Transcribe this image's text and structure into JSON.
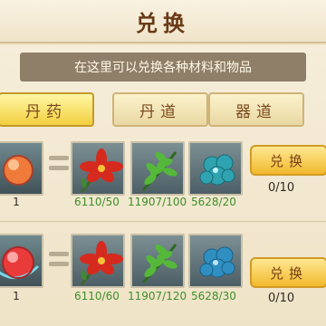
{
  "header": {
    "title": "兑换"
  },
  "info": {
    "text": "在这里可以兑换各种材料和物品"
  },
  "tabs": [
    {
      "label": "丹药",
      "active": true
    },
    {
      "label": "丹道",
      "active": false
    },
    {
      "label": "器道",
      "active": false
    }
  ],
  "rows": [
    {
      "target": {
        "icon": "orange-orb-icon",
        "count": "1"
      },
      "materials": [
        {
          "icon": "red-flower-icon",
          "stock": "6110/50"
        },
        {
          "icon": "green-herb-icon",
          "stock": "11907/100"
        },
        {
          "icon": "blue-crystal-icon",
          "stock": "5628/20"
        }
      ],
      "button_label": "兑换",
      "limit": "0/10"
    },
    {
      "target": {
        "icon": "red-orb-icon",
        "count": "1"
      },
      "materials": [
        {
          "icon": "red-flower-icon",
          "stock": "6110/60"
        },
        {
          "icon": "green-herb-icon",
          "stock": "11907/120"
        },
        {
          "icon": "blue-crystal-icon",
          "stock": "5628/30"
        }
      ],
      "button_label": "兑换",
      "limit": "0/10"
    }
  ],
  "colors": {
    "accent": "#f1b92d",
    "stock_text": "#3f8f2a",
    "title": "#6a3a16"
  }
}
